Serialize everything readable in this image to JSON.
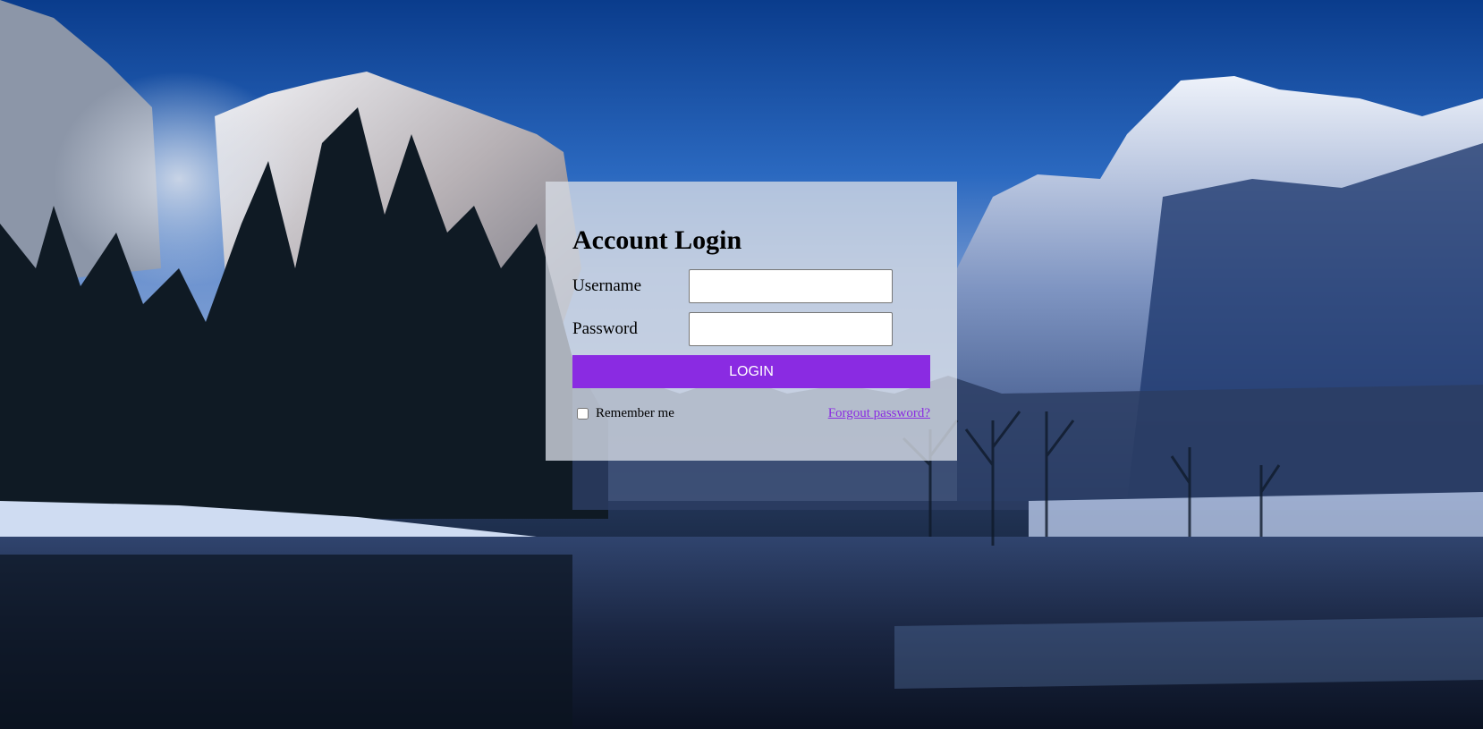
{
  "login": {
    "title": "Account Login",
    "username_label": "Username",
    "username_value": "",
    "password_label": "Password",
    "password_value": "",
    "login_button_label": "LOGIN",
    "remember_label": "Remember me",
    "remember_checked": false,
    "forgot_link_label": "Forgout password?"
  },
  "colors": {
    "accent": "#8a2be2",
    "panel_background": "rgba(215,220,230,0.78)"
  },
  "background": {
    "icon": "mountain-lake-winter-scene"
  }
}
